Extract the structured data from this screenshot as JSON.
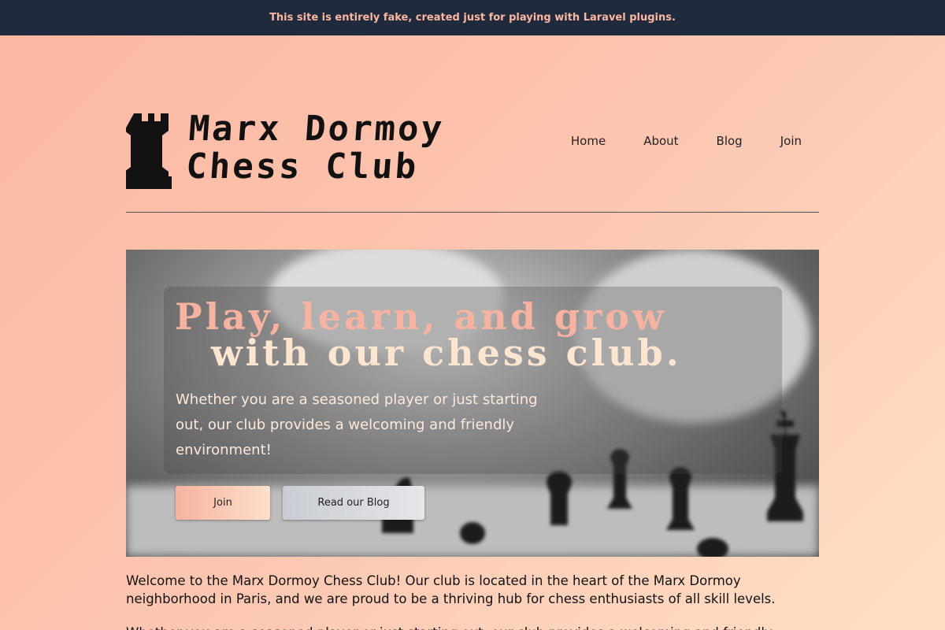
{
  "banner": {
    "text": "This site is entirely fake, created just for playing with Laravel plugins."
  },
  "header": {
    "logo_line1": "Marx Dormoy",
    "logo_line2": "Chess Club",
    "nav": [
      "Home",
      "About",
      "Blog",
      "Join"
    ]
  },
  "hero": {
    "title_line1": "Play, learn, and grow",
    "title_line2": "with our chess club.",
    "subtitle": "Whether you are a seasoned player or just starting out, our club provides a welcoming and friendly environment!",
    "join_button": "Join",
    "blog_button": "Read our Blog"
  },
  "intro": {
    "paragraph1": "Welcome to the Marx Dormoy Chess Club! Our club is located in the heart of the Marx Dormoy neighborhood in Paris, and we are proud to be a thriving hub for chess enthusiasts of all skill levels.",
    "paragraph2": "Whether you are a seasoned player or just starting out, our club provides a welcoming and friendly"
  },
  "colors": {
    "banner_bg": "#1f2a3c",
    "accent_salmon": "#f7b39f",
    "accent_cream": "#fde6cf"
  },
  "icons": {
    "logo": "chess-rook-icon"
  }
}
